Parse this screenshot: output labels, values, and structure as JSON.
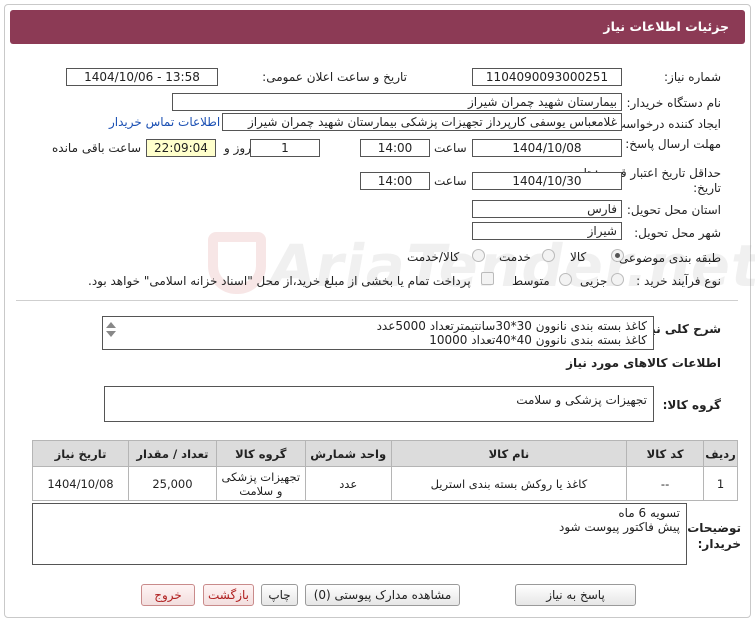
{
  "header": {
    "title": "جزئیات اطلاعات نیاز"
  },
  "fields": {
    "need_number_label": "شماره نیاز:",
    "need_number": "1104090093000251",
    "announce_label": "تاریخ و ساعت اعلان عمومی:",
    "announce_value": "1404/10/06 - 13:58",
    "buyer_org_label": "نام دستگاه خریدار:",
    "buyer_org": "بیمارستان شهید چمران شیراز",
    "creator_label": "ایجاد کننده درخواست:",
    "creator": "غلامعباس  یوسفی کارپرداز تجهیزات پزشکی بیمارستان شهید چمران شیراز",
    "contact_link": "اطلاعات تماس خریدار",
    "deadline_label": "مهلت ارسال پاسخ: تا تاریخ:",
    "deadline_date": "1404/10/08",
    "time_label": "ساعت",
    "deadline_time": "14:00",
    "days_value": "1",
    "days_label": "روز و",
    "remaining_time": "22:09:04",
    "remaining_label": "ساعت باقی مانده",
    "min_validity_label": "حداقل تاریخ اعتبار قیمت: تا تاریخ:",
    "validity_date": "1404/10/30",
    "validity_time": "14:00",
    "province_label": "استان محل تحویل:",
    "province": "فارس",
    "city_label": "شهر محل تحویل:",
    "city": "شیراز",
    "category_label": "طبقه بندی موضوعی:",
    "category_options": [
      "کالا",
      "خدمت",
      "کالا/خدمت"
    ],
    "process_label": "نوع فرآیند خرید :",
    "process_options": [
      "جزیی",
      "متوسط"
    ],
    "payment_note": "پرداخت تمام یا بخشی از مبلغ خرید،از محل \"اسناد خزانه اسلامی\" خواهد بود."
  },
  "summary": {
    "label": "شرح کلی نیاز:",
    "line1": "کاغذ بسته بندی نانوون 30*30سانتیمترتعداد 5000عدد",
    "line2": "کاغذ بسته بندی نانوون 40*40تعداد 10000"
  },
  "goods": {
    "section_title": "اطلاعات کالاهای مورد نیاز",
    "group_label": "گروه کالا:",
    "group_value": "تجهیزات پزشکی و سلامت",
    "columns": [
      "ردیف",
      "کد کالا",
      "نام کالا",
      "واحد شمارش",
      "گروه کالا",
      "تعداد / مقدار",
      "تاریخ نیاز"
    ],
    "rows": [
      {
        "index": "1",
        "code": "--",
        "name": "کاغذ یا روکش بسته بندی استریل",
        "unit": "عدد",
        "group": "تجهیزات پزشکی و سلامت",
        "qty": "25,000",
        "date": "1404/10/08"
      }
    ]
  },
  "buyer_notes": {
    "label": "توضیحات خریدار:",
    "line1": "تسویه  6 ماه",
    "line2": "پیش فاکتور پیوست شود"
  },
  "buttons": {
    "reply": "پاسخ به نیاز",
    "attachments": "مشاهده مدارک پیوستی (0)",
    "print": "چاپ",
    "back": "بازگشت",
    "exit": "خروج"
  },
  "watermark": "AriaTender.net",
  "colors": {
    "header_bg": "#8c3a55",
    "link": "#1a4fb3",
    "remaining_bg": "#ffffcc"
  }
}
